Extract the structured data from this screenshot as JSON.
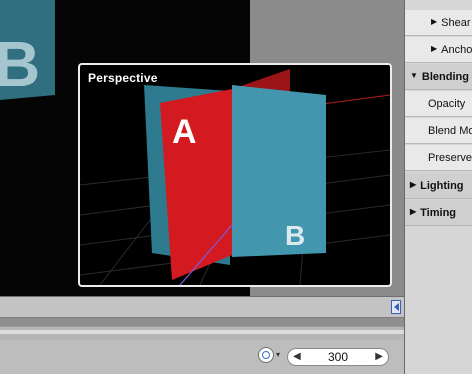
{
  "viewer": {
    "label": "Perspective",
    "card_a_letter": "A",
    "card_b_letter": "B",
    "background_b_letter": "B"
  },
  "inspector": {
    "items": [
      {
        "label": "Shear",
        "kind": "subgroup"
      },
      {
        "label": "Anchor",
        "kind": "subgroup"
      },
      {
        "label": "Blending",
        "kind": "group",
        "expanded": true
      },
      {
        "label": "Opacity",
        "kind": "param"
      },
      {
        "label": "Blend Mode",
        "kind": "param"
      },
      {
        "label": "Preserve Opacity",
        "kind": "param"
      },
      {
        "label": "Lighting",
        "kind": "group",
        "expanded": false
      },
      {
        "label": "Timing",
        "kind": "group",
        "expanded": false
      }
    ]
  },
  "timeline": {
    "current_frame": "300"
  },
  "icons": {
    "collapsed": "▶",
    "expanded": "▼",
    "step_back": "◀",
    "step_forward": "▶",
    "frame_menu": "▾"
  },
  "colors": {
    "card_red": "#d21a20",
    "card_teal": "#3d8fa6",
    "playhead_blue": "#3a5fb8"
  }
}
